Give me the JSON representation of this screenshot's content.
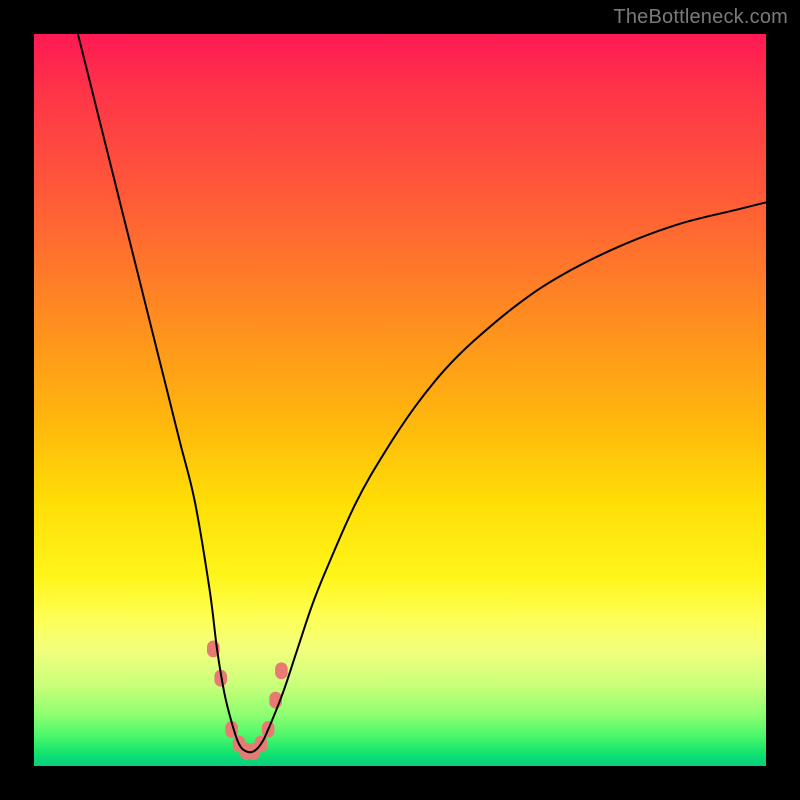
{
  "watermark": "TheBottleneck.com",
  "chart_data": {
    "type": "line",
    "title": "",
    "xlabel": "",
    "ylabel": "",
    "xlim": [
      0,
      100
    ],
    "ylim": [
      0,
      100
    ],
    "grid": false,
    "series": [
      {
        "name": "bottleneck-curve",
        "x": [
          6,
          8,
          10,
          12,
          14,
          16,
          18,
          20,
          22,
          24,
          25,
          26,
          27,
          28,
          29,
          30,
          31,
          32,
          34,
          36,
          38,
          40,
          44,
          48,
          52,
          56,
          60,
          66,
          72,
          80,
          88,
          96,
          100
        ],
        "y": [
          100,
          92,
          84,
          76,
          68,
          60,
          52,
          44,
          36,
          24,
          16,
          10,
          6,
          3,
          2,
          2,
          3,
          5,
          10,
          16,
          22,
          27,
          36,
          43,
          49,
          54,
          58,
          63,
          67,
          71,
          74,
          76,
          77
        ],
        "color": "#000000",
        "stroke_width": 2
      },
      {
        "name": "optimal-markers",
        "x": [
          24.5,
          25.5,
          27.0,
          28.0,
          29.0,
          30.0,
          31.0,
          32.0,
          33.0,
          33.8
        ],
        "y": [
          16,
          12,
          5,
          3,
          2,
          2,
          3,
          5,
          9,
          13
        ],
        "color": "#e77b74",
        "marker": "pill",
        "marker_size": 14
      }
    ]
  }
}
